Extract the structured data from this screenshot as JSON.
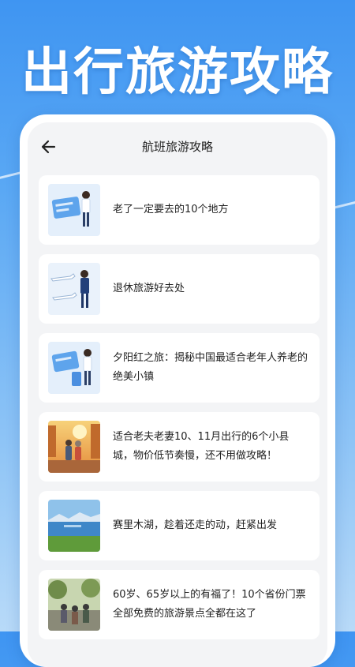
{
  "hero": {
    "title": "出行旅游攻略"
  },
  "header": {
    "title": "航班旅游攻略",
    "back_icon": "arrow-left-icon"
  },
  "articles": [
    {
      "title": "老了一定要去的10个地方",
      "thumb": "boarding-pass-illustration"
    },
    {
      "title": "退休旅游好去处",
      "thumb": "airplane-traveler-illustration"
    },
    {
      "title": "夕阳红之旅：揭秘中国最适合老年人养老的绝美小镇",
      "thumb": "ticket-luggage-illustration"
    },
    {
      "title": "适合老夫老妻10、11月出行的6个小县城，物价低节奏慢，还不用做攻略！",
      "thumb": "elderly-couple-autumn-photo"
    },
    {
      "title": "赛里木湖，趁着还走的动，赶紧出发",
      "thumb": "lake-landscape-photo"
    },
    {
      "title": "60岁、65岁以上的有福了！10个省份门票全部免费的旅游景点全都在这了",
      "thumb": "tourists-scenic-spot-photo"
    }
  ],
  "colors": {
    "accent": "#3f95f2",
    "card": "#ffffff",
    "screen_bg": "#f3f4f6",
    "text": "#222222"
  }
}
